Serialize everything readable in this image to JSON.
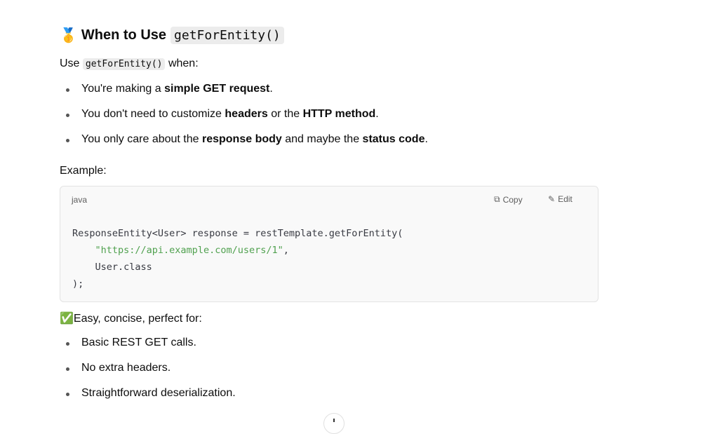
{
  "heading": {
    "emoji": "🥇",
    "text": "When to Use",
    "code": "getForEntity()"
  },
  "intro": {
    "pre": "Use",
    "code": "getForEntity()",
    "post": "when:"
  },
  "bullets1": [
    {
      "parts": [
        "You're making a ",
        "simple GET request",
        "."
      ]
    },
    {
      "parts": [
        "You don't need to customize ",
        "headers",
        " or the ",
        "HTTP method",
        "."
      ]
    },
    {
      "parts": [
        "You only care about the ",
        "response body",
        " and maybe the ",
        "status code",
        "."
      ]
    }
  ],
  "example_label": "Example:",
  "code_block": {
    "language": "java",
    "copy_label": "Copy",
    "edit_label": "Edit",
    "line1": "ResponseEntity<User> response = restTemplate.getForEntity(",
    "line2_indent": "    ",
    "line2_str": "\"https://api.example.com/users/1\"",
    "line2_tail": ",",
    "line3": "    User.class",
    "line4": ");"
  },
  "summary": {
    "emoji": "✅",
    "text": "Easy, concise, perfect for:"
  },
  "bullets2": [
    "Basic REST GET calls.",
    "No extra headers.",
    "Straightforward deserialization."
  ]
}
